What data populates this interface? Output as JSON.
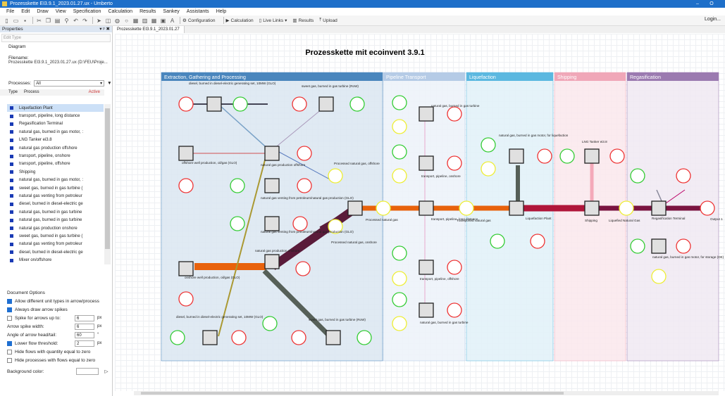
{
  "window": {
    "title": "Prozesskette EI3.9.1_2023.01.27.ux - Umberto",
    "minimize": "–",
    "restore": "O"
  },
  "menu": [
    "File",
    "Edit",
    "Draw",
    "View",
    "Specification",
    "Calculation",
    "Results",
    "Sankey",
    "Assistants",
    "Help"
  ],
  "toolbar": {
    "configuration": "Configuration",
    "calculation": "Calculation",
    "live_links": "Live Links",
    "results": "Results",
    "upload": "Upload"
  },
  "login": "Login...",
  "properties": {
    "title": "Properties",
    "controls": "▾ ᵖ ✖",
    "edit_type": "Edit Type",
    "diagram_label": "Diagram",
    "filename_label": "Filename:",
    "filename": "Prozesskette EI3.9.1_2023.01.27.ux (D:\\FEU\\Proje...",
    "processes_label": "Processes:",
    "processes_filter": "All",
    "col_type": "Type",
    "col_process": "Process",
    "col_active": "Active",
    "processes": [
      "Liquefaction Plant",
      "transport, pipeline, long distance",
      "Regasification Terminal",
      "natural gas, burned in gas motor, :",
      "LNG Tanker ei3.8",
      "natural gas production offshore",
      "transport, pipeline, onshore",
      "transport, pipeline, offshore",
      "Shipping",
      "natural gas, burned in gas motor, :",
      "sweet gas, burned in gas turbine (",
      "natural gas venting from petroleur",
      "diesel, burned in diesel-electric ge",
      "natural gas, burned in gas turbine",
      "natural gas, burned in gas turbine",
      "natural gas production onshore",
      "sweet gas, burned in gas turbine (",
      "natural gas venting from petroleur",
      "diesel, burned in diesel-electric ge",
      "Mixer on/offshore"
    ]
  },
  "doc_options": {
    "title": "Document Options",
    "allow_diff": "Allow different unit types in arrow/process",
    "always_spikes": "Always draw arrow spikes",
    "spike_upto": "Spike for arrows up to:",
    "spike_upto_val": "6",
    "arrow_spike_width": "Arrow spike width:",
    "arrow_spike_width_val": "6",
    "angle": "Angle of arrow head/tail:",
    "angle_val": "60",
    "lower_flow": "Lower flow threshold:",
    "lower_flow_val": "2",
    "hide_flows": "Hide flows with quantity equal to zero",
    "hide_processes": "Hide processes with flows equal to zero",
    "bg_color": "Background color:",
    "unit_px": "px",
    "unit_deg": "°"
  },
  "tab": "Prozesskette EI3.9.1_2023.01.27",
  "diagram": {
    "title": "Prozesskette mit ecoinvent 3.9.1",
    "stages": [
      {
        "label": "Extraction, Gathering and Processing",
        "color": "#4a86bd",
        "fill": "#dde8f2"
      },
      {
        "label": "Pipeline Transport",
        "color": "#b5cbe6",
        "fill": "#eef3fa"
      },
      {
        "label": "Liquefaction",
        "color": "#5bb8e0",
        "fill": "#e3f2f9"
      },
      {
        "label": "Shipping",
        "color": "#f0a7b8",
        "fill": "#fbe9ee"
      },
      {
        "label": "Regasification",
        "color": "#9b7ab0",
        "fill": "#f1eaf3"
      }
    ],
    "labels": {
      "diesel_top": "diesel, burned in diesel-electric generating set, 10MW (GLO)",
      "sweet_top": "sweet gas, burned in gas turbine (RoW)",
      "offshore_prod": "offshore well production, oil/gas (GLO)",
      "ng_prod_offshore": "natural gas production offshore",
      "processed_offshore": "Processed natural gas, offshore",
      "venting1": "natural gas venting from petroleum/natural gas production (GLO)",
      "venting2": "natural gas venting from petroleum/natural gas production (GLO)",
      "processed_ng": "Processed natural gas",
      "processed_onshore": "Processed natural gas, onshore",
      "ng_prod_onshore": "natural gas production onshore",
      "onshore_prod": "onshore well production, oil/gas (GLO)",
      "diesel_bottom": "diesel, burned in diesel-electric generating set, 10MW (GLO)",
      "sweet_bottom": "sweet gas, burned in gas turbine (RoW)",
      "ng_turbine1": "natural gas, burned in gas turbine",
      "transport_onshore": "transport, pipeline, onshore",
      "transport_long": "transport, pipeline, long distance",
      "transported": "Transported natural gas",
      "transport_offshore": "transport, pipeline, offshore",
      "ng_turbine2": "natural gas, burned in gas turbine",
      "ng_motor_liq": "natural gas, burned in gas motor, for liquefaction",
      "liq_plant": "Liquefaction Plant",
      "lng_tanker": "LNG Tanker ei3.8",
      "shipping": "Shipping",
      "liquefied": "Liquefied Natural Gas",
      "regas_terminal": "Regasification Terminal",
      "output": "Output 1",
      "ng_motor_storage": "natural gas, burned in gas motor, for storage (DE)"
    }
  }
}
